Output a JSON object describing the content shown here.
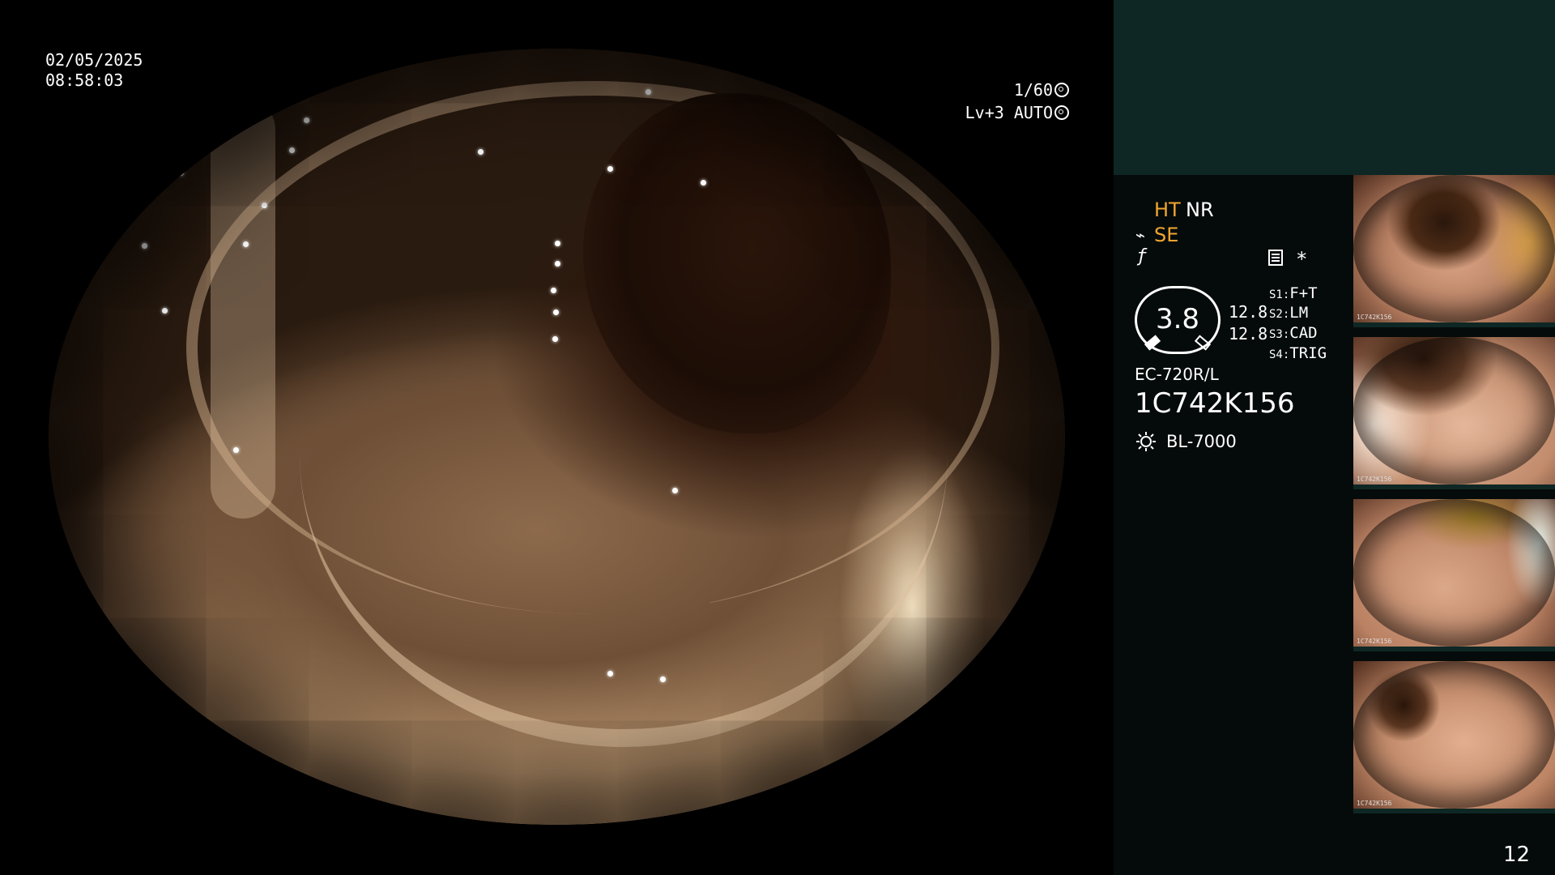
{
  "overlay": {
    "date": "02/05/2025",
    "time": "08:58:03",
    "shutter": "1/60",
    "iris": "Lv+3 AUTO"
  },
  "status": {
    "modes": {
      "ht": "HT",
      "nr": "NR",
      "se": "SE"
    },
    "star": "*",
    "gauge_value": "3.8",
    "gauge_n1": "12.8",
    "gauge_n2": "12.8",
    "switches": [
      {
        "key": "S1:",
        "value": "F+T"
      },
      {
        "key": "S2:",
        "value": "LM"
      },
      {
        "key": "S3:",
        "value": "CAD"
      },
      {
        "key": "S4:",
        "value": "TRIG"
      }
    ],
    "scope_model": "EC-720R/L",
    "scope_serial": "1C742K156",
    "light_source": "BL-7000"
  },
  "thumbnails": [
    {
      "serial": "1C742K156"
    },
    {
      "serial": "1C742K156"
    },
    {
      "serial": "1C742K156"
    },
    {
      "serial": "1C742K156"
    }
  ],
  "page_number": "12",
  "colors": {
    "panel_top": "#0e2724",
    "panel": "#050b0a",
    "mode_active": "#f2a531"
  }
}
